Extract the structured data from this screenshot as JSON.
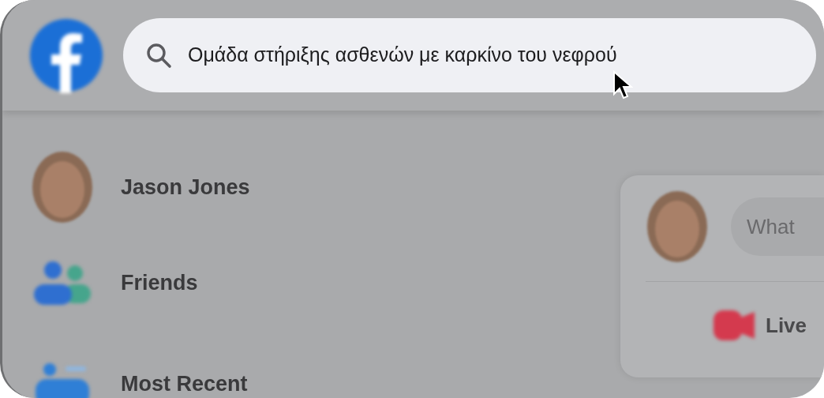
{
  "header": {
    "search": {
      "value": "Ομάδα στήριξης ασθενών με καρκίνο του νεφρού"
    }
  },
  "sidebar": {
    "items": [
      {
        "kind": "profile",
        "label": "Jason Jones"
      },
      {
        "kind": "friends",
        "label": "Friends"
      },
      {
        "kind": "recent",
        "label": "Most Recent"
      }
    ]
  },
  "composer": {
    "placeholder": "What",
    "actions": [
      {
        "kind": "live",
        "label": "Live"
      }
    ]
  }
}
